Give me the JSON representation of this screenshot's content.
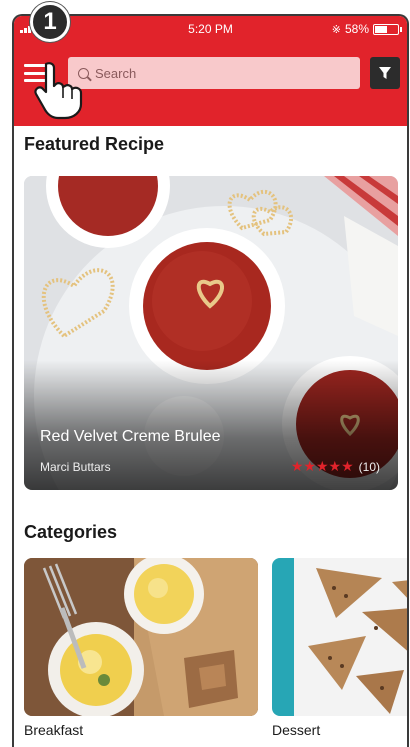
{
  "step_badge": "1",
  "status_bar": {
    "time": "5:20 PM",
    "battery_percent": "58%",
    "battery_level": 0.58
  },
  "search": {
    "placeholder": "Search"
  },
  "featured": {
    "section_title": "Featured Recipe",
    "recipe_name": "Red Velvet Creme Brulee",
    "author": "Marci Buttars",
    "rating_stars": 5,
    "rating_count": "(10)"
  },
  "categories": {
    "section_title": "Categories",
    "items": [
      {
        "label": "Breakfast"
      },
      {
        "label": "Dessert"
      }
    ]
  },
  "colors": {
    "brand_red": "#e1232b",
    "search_bg": "#f8c9cb",
    "filter_bg": "#2c2c2c"
  },
  "icons": {
    "menu": "hamburger-menu-icon",
    "search": "magnifier-icon",
    "filter": "funnel-icon",
    "bluetooth": "bluetooth-icon",
    "battery": "battery-icon",
    "tap": "pointing-hand-icon",
    "star": "star-icon"
  }
}
